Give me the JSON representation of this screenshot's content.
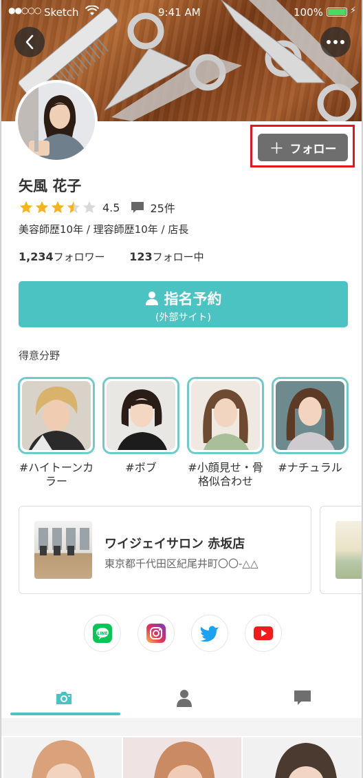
{
  "status_bar": {
    "signal": "●●○○○",
    "carrier": "Sketch",
    "time": "9:41 AM",
    "battery": "100%"
  },
  "header": {
    "back_icon": "chevron-left-icon",
    "more_icon": "ellipsis-icon"
  },
  "profile": {
    "follow_label": "フォロー",
    "name": "矢風 花子",
    "rating": 3.5,
    "rating_text": "4.5",
    "review_count": "25件",
    "career": "美容師歴10年 / 理容師歴10年 / 店長",
    "followers_count": "1,234",
    "followers_label": "フォロワー",
    "following_count": "123",
    "following_label": "フォロー中"
  },
  "reserve_button": {
    "label": "指名予約",
    "sublabel": "(外部サイト)"
  },
  "specialties": {
    "title": "得意分野",
    "items": [
      {
        "label": "#ハイトーンカラー"
      },
      {
        "label": "#ボブ"
      },
      {
        "label": "#小顔見せ・骨格似合わせ"
      },
      {
        "label": "#ナチュラル"
      }
    ]
  },
  "salon": {
    "name": "ワイジェイサロン 赤坂店",
    "address": "東京都千代田区紀尾井町〇〇-△△"
  },
  "sns": [
    "line-icon",
    "instagram-icon",
    "twitter-icon",
    "youtube-icon"
  ],
  "tabs": [
    "camera-icon",
    "person-icon",
    "chat-icon"
  ],
  "colors": {
    "accent": "#4cc3c3",
    "follow_button": "#6e6e6e",
    "highlight": "#e8141b",
    "star": "#f5b31e"
  }
}
